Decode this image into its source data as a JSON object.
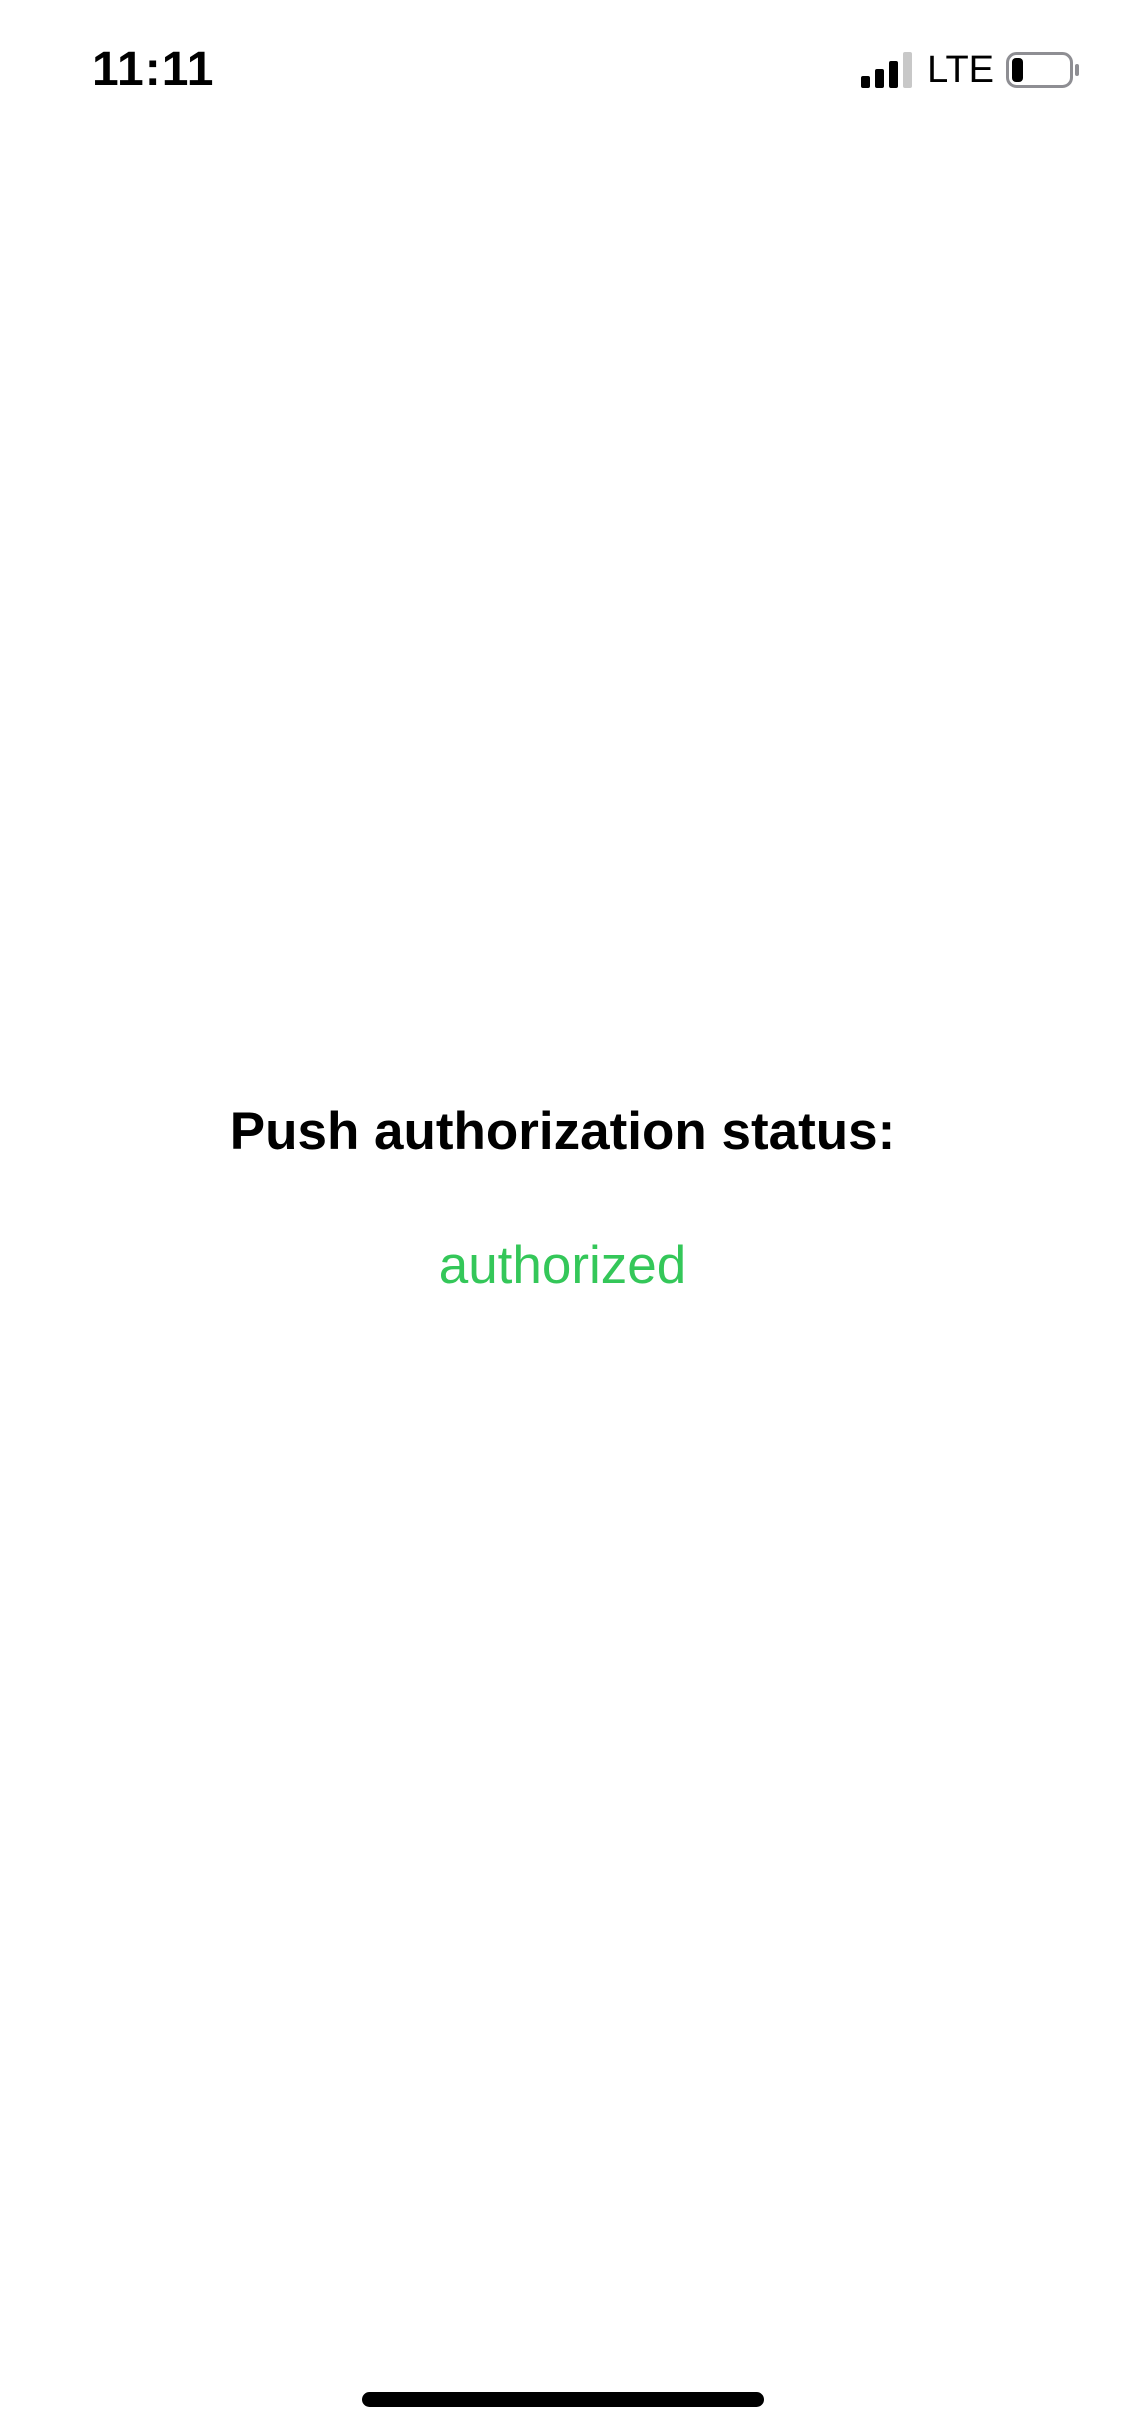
{
  "status_bar": {
    "time": "11:11",
    "signal_icon": "cellular-signal-icon",
    "signal_bars_filled": 3,
    "signal_bars_total": 4,
    "network": "LTE",
    "battery_icon": "battery-icon",
    "battery_level": 0.2
  },
  "main": {
    "heading": "Push authorization status:",
    "status_value": "authorized",
    "status_color": "#34c759"
  },
  "home_indicator_icon": "home-indicator"
}
